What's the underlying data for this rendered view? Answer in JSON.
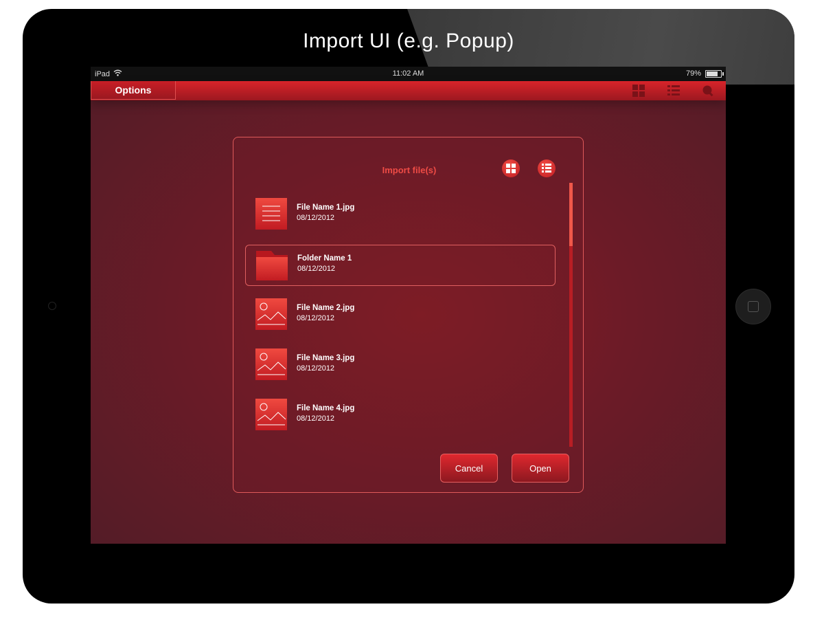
{
  "page": {
    "heading": "Import UI (e.g. Popup)"
  },
  "status_bar": {
    "device": "iPad",
    "time": "11:02 AM",
    "battery": "79%",
    "battery_level": 0.79
  },
  "nav": {
    "options_label": "Options",
    "icons": [
      "grid-view-icon",
      "list-view-icon",
      "search-icon"
    ]
  },
  "dialog": {
    "title": "Import file(s)",
    "view_icons": [
      "grid-view-icon",
      "list-view-icon"
    ],
    "items": [
      {
        "name": "File Name 1.jpg",
        "date": "08/12/2012",
        "icon": "document-icon",
        "selected": false
      },
      {
        "name": "Folder Name 1",
        "date": "08/12/2012",
        "icon": "folder-icon",
        "selected": true
      },
      {
        "name": "File Name 2.jpg",
        "date": "08/12/2012",
        "icon": "image-icon",
        "selected": false
      },
      {
        "name": "File Name 3.jpg",
        "date": "08/12/2012",
        "icon": "image-icon",
        "selected": false
      },
      {
        "name": "File Name 4.jpg",
        "date": "08/12/2012",
        "icon": "image-icon",
        "selected": false
      }
    ],
    "scroll_position": 0.0,
    "scroll_visible_fraction": 0.24,
    "cancel_label": "Cancel",
    "open_label": "Open"
  },
  "colors": {
    "accent": "#e5302e",
    "title_accent": "#ee4b45",
    "screen_background": "#6c1b27",
    "device_frame": "#000000"
  }
}
